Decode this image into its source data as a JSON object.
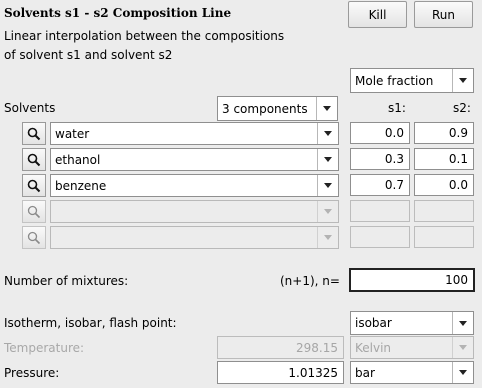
{
  "header": {
    "title": "Solvents s1 - s2 Composition Line",
    "kill_label": "Kill",
    "run_label": "Run",
    "description_line1": "Linear interpolation between the compositions",
    "description_line2": "of solvent s1 and solvent s2"
  },
  "units_select": {
    "value": "Mole fraction"
  },
  "solvents": {
    "label": "Solvents",
    "components_select": "3 components",
    "s1_header": "s1:",
    "s2_header": "s2:",
    "rows": [
      {
        "name": "water",
        "s1": "0.0",
        "s2": "0.9",
        "enabled": true
      },
      {
        "name": "ethanol",
        "s1": "0.3",
        "s2": "0.1",
        "enabled": true
      },
      {
        "name": "benzene",
        "s1": "0.7",
        "s2": "0.0",
        "enabled": true
      },
      {
        "name": "",
        "s1": "",
        "s2": "",
        "enabled": false
      },
      {
        "name": "",
        "s1": "",
        "s2": "",
        "enabled": false
      }
    ]
  },
  "mixtures": {
    "label": "Number of mixtures:",
    "formula": "(n+1), n=",
    "value": "100"
  },
  "conditions": {
    "mode_label": "Isotherm, isobar, flash point:",
    "mode_value": "isobar",
    "temperature_label": "Temperature:",
    "temperature_value": "298.15",
    "temperature_unit": "Kelvin",
    "pressure_label": "Pressure:",
    "pressure_value": "1.01325",
    "pressure_unit": "bar"
  }
}
